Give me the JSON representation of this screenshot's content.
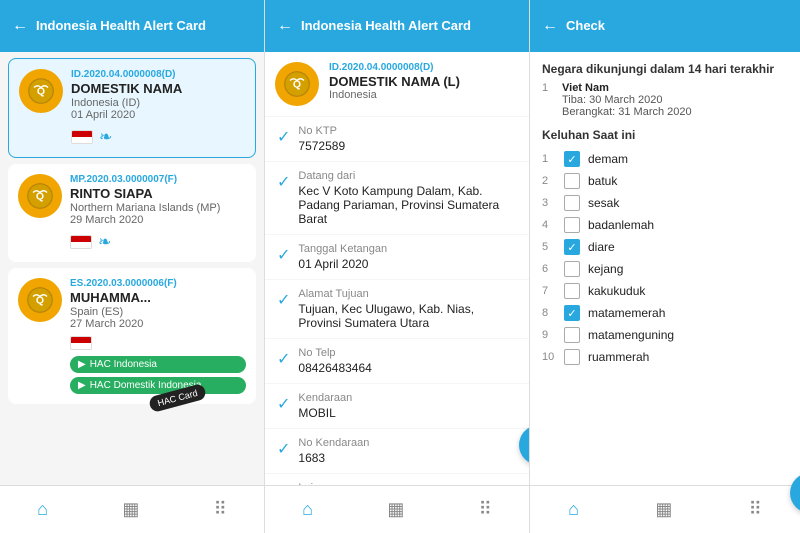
{
  "panels": {
    "left": {
      "header": {
        "back_label": "←",
        "title": "Indonesia Health Alert Card"
      },
      "cards": [
        {
          "id": "ID.2020.04.0000008(D)",
          "name": "DOMESTIK NAMA",
          "country": "Indonesia (ID)",
          "date": "01 April 2020",
          "active": true
        },
        {
          "id": "MP.2020.03.0000007(F)",
          "name": "RINTO SIAPA",
          "country": "Northern Mariana Islands (MP)",
          "date": "29 March 2020",
          "active": false
        },
        {
          "id": "ES.2020.03.0000006(F)",
          "name": "MUHAMMA...",
          "country": "Spain (ES)",
          "date": "27 March 2020",
          "active": false,
          "has_hac": true
        }
      ],
      "hac_buttons": {
        "hac_indonesia": "HAC Indonesia",
        "hac_domestik": "HAC Domestik Indonesia",
        "hac_card": "HAC Card"
      }
    },
    "middle": {
      "header": {
        "back_label": "←",
        "title": "Indonesia Health Alert Card"
      },
      "card": {
        "id": "ID.2020.04.0000008(D)",
        "name": "DOMESTIK NAMA (L)",
        "country": "Indonesia"
      },
      "fields": [
        {
          "label": "No KTP",
          "value": "7572589",
          "checked": true
        },
        {
          "label": "Datang dari",
          "value": "Kec V Koto Kampung Dalam, Kab. Padang Pariaman, Provinsi Sumatera Barat",
          "checked": true
        },
        {
          "label": "Tanggal Ketangan",
          "value": "01 April 2020",
          "checked": true
        },
        {
          "label": "Alamat Tujuan",
          "value": "Tujuan, Kec Ulugawo, Kab. Nias, Provinsi Sumatera Utara",
          "checked": true
        },
        {
          "label": "No Telp",
          "value": "08426483464",
          "checked": true
        },
        {
          "label": "Kendaraan",
          "value": "MOBIL",
          "checked": true
        },
        {
          "label": "No Kendaraan",
          "value": "1683",
          "checked": true
        },
        {
          "label": "Lainnya",
          "value": "",
          "checked": true
        }
      ]
    },
    "right": {
      "header": {
        "back_label": "←",
        "title": "Check"
      },
      "visited_section_title": "Negara dikunjungi dalam 14 hari terakhir",
      "visits": [
        {
          "num": "1",
          "country": "Viet Nam",
          "arrival": "Tiba: 30 March 2020",
          "departure": "Berangkat: 31 March 2020"
        }
      ],
      "keluhan_title": "Keluhan Saat ini",
      "keluhan": [
        {
          "num": "1",
          "label": "demam",
          "checked": true
        },
        {
          "num": "2",
          "label": "batuk",
          "checked": false
        },
        {
          "num": "3",
          "label": "sesak",
          "checked": false
        },
        {
          "num": "4",
          "label": "badanlemah",
          "checked": false
        },
        {
          "num": "5",
          "label": "diare",
          "checked": true
        },
        {
          "num": "6",
          "label": "kejang",
          "checked": false
        },
        {
          "num": "7",
          "label": "kakukuduk",
          "checked": false
        },
        {
          "num": "8",
          "label": "matamemerah",
          "checked": true
        },
        {
          "num": "9",
          "label": "matamenguning",
          "checked": false
        },
        {
          "num": "10",
          "label": "ruammerah",
          "checked": false
        }
      ]
    }
  },
  "nav": {
    "home_icon": "⌂",
    "card_icon": "▦",
    "grid_icon": "⠿"
  }
}
